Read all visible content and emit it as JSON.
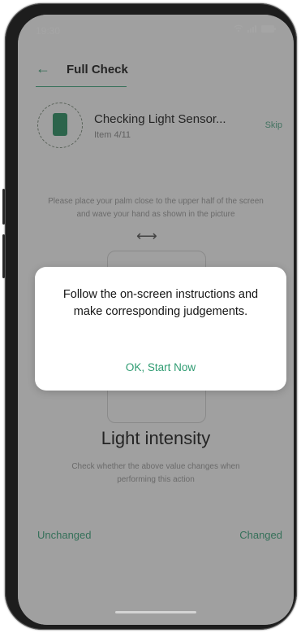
{
  "status_bar": {
    "time": "19:30",
    "wifi_icon": "wifi-icon",
    "signal_icon": "signal-icon",
    "battery_icon": "battery-icon"
  },
  "header": {
    "back_icon": "back-arrow-icon",
    "title": "Full Check"
  },
  "check": {
    "title": "Checking Light Sensor...",
    "item": "Item 4/11",
    "skip": "Skip",
    "icon": "phone-icon"
  },
  "instruction": "Please place your palm close to the upper half of the screen and wave your hand as shown in the picture",
  "illustration": {
    "wave_icon": "wave-arrows-icon"
  },
  "sensor": {
    "label": "Light intensity",
    "description": "Check whether the above value changes when performing this action"
  },
  "actions": {
    "unchanged": "Unchanged",
    "changed": "Changed"
  },
  "dialog": {
    "message": "Follow the on-screen instructions and make corresponding judgements.",
    "button": "OK, Start Now"
  },
  "colors": {
    "accent": "#2f9c72",
    "overlay": "#282828"
  }
}
